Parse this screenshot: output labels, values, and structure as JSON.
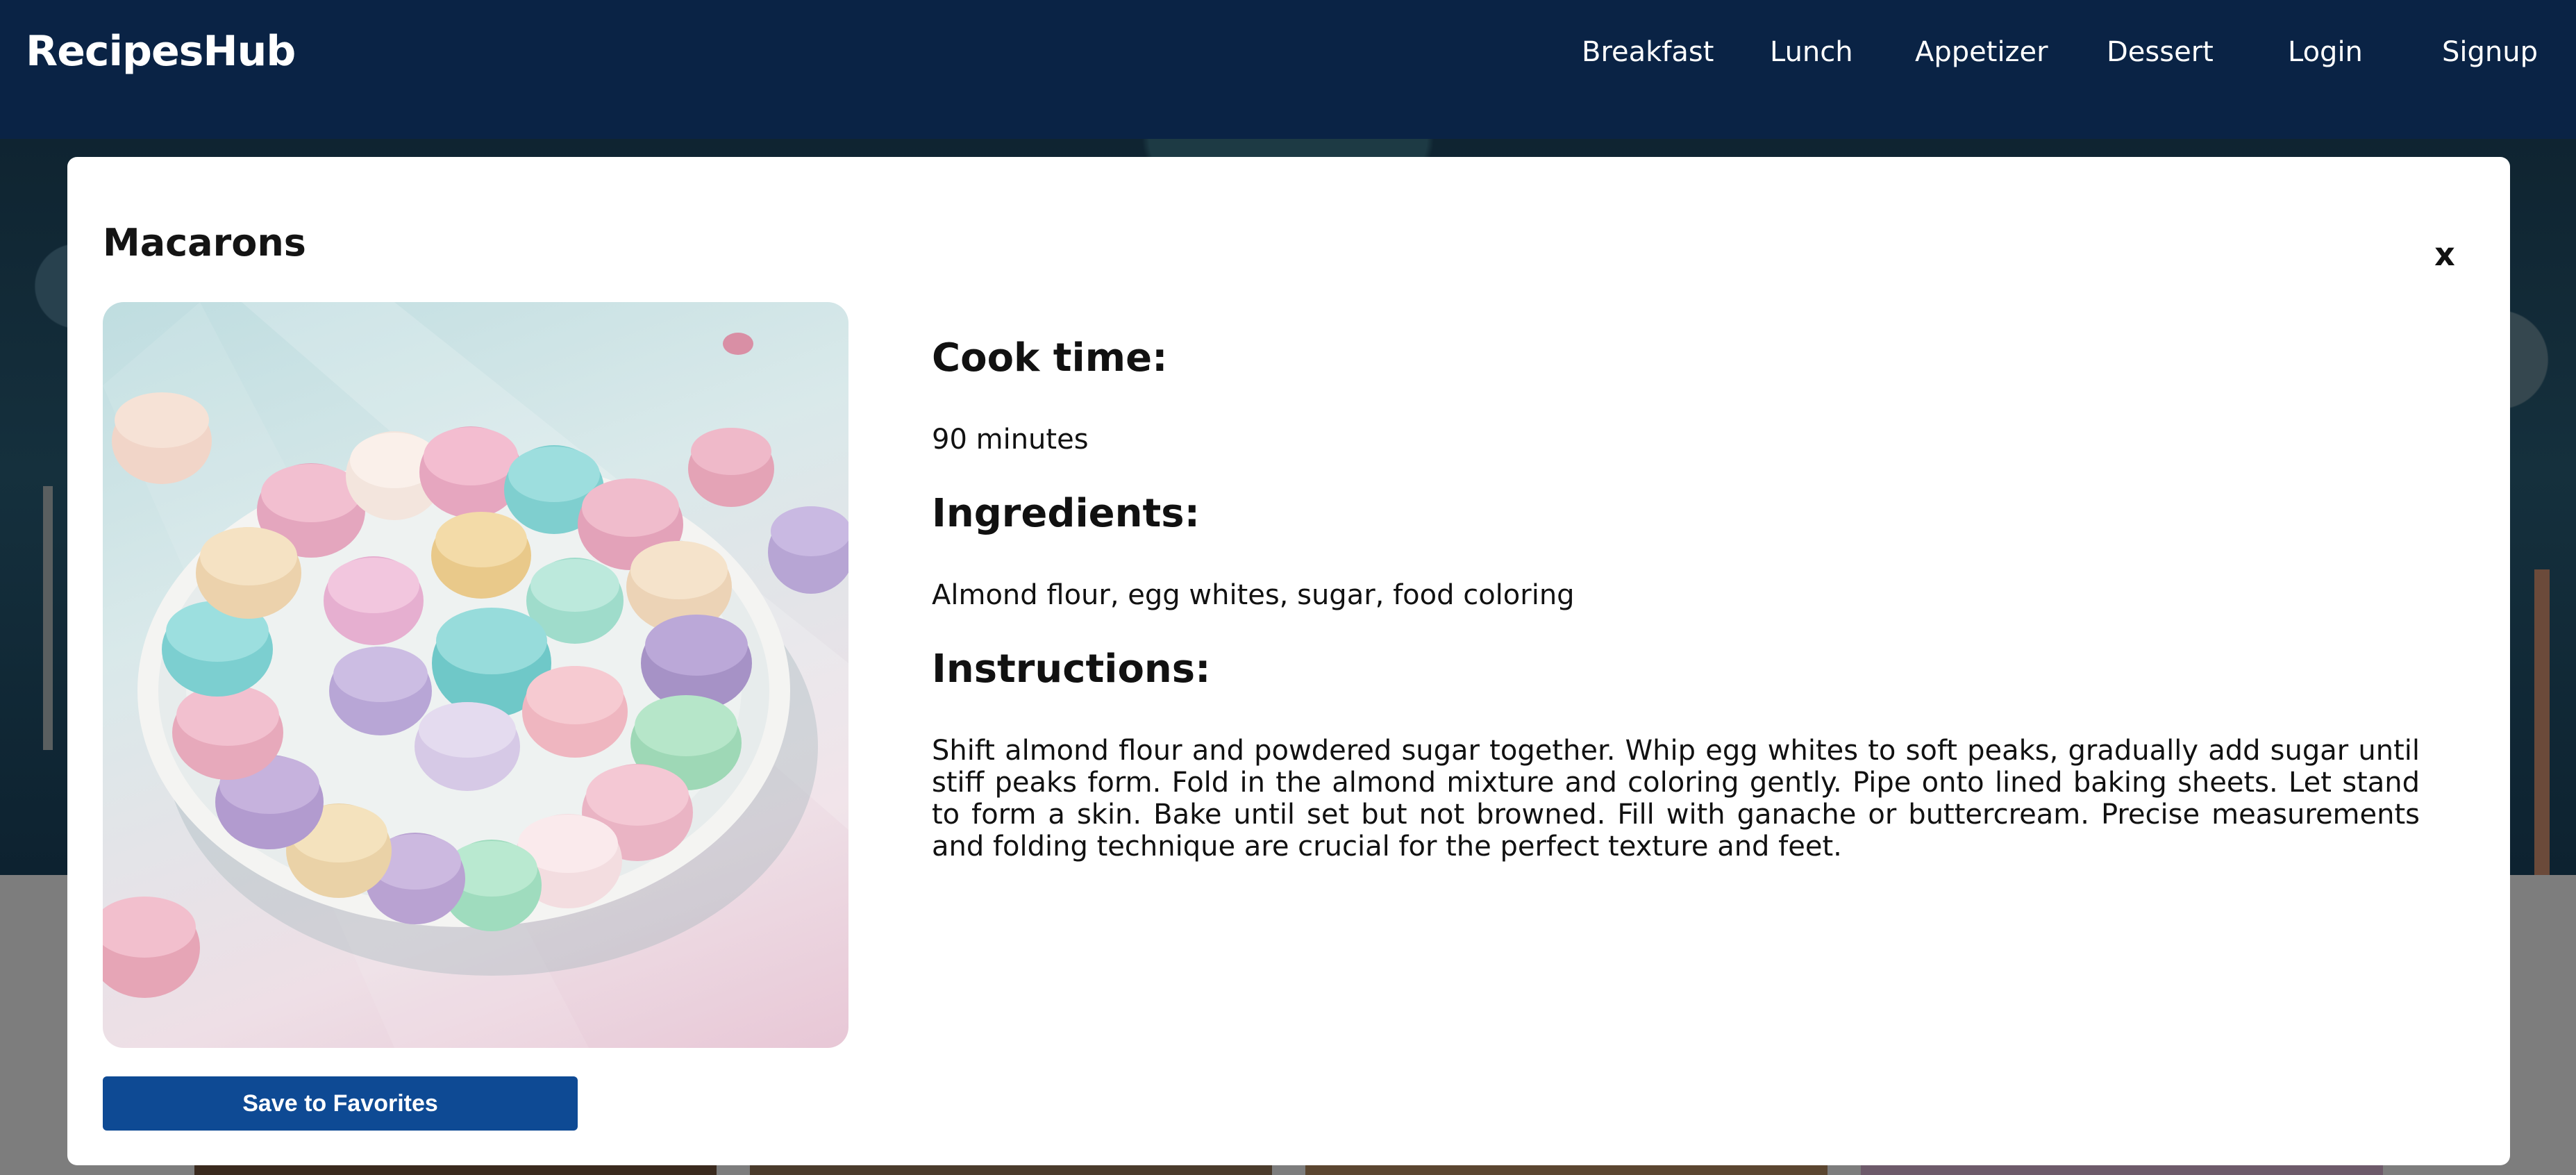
{
  "navbar": {
    "brand": "RecipesHub",
    "links": [
      "Breakfast",
      "Lunch",
      "Appetizer",
      "Dessert"
    ],
    "login_label": "Login",
    "signup_label": "Signup"
  },
  "modal": {
    "title": "Macarons",
    "close_label": "x",
    "image_alt": "Plate of pastel macarons",
    "cook_time_heading": "Cook time:",
    "cook_time": "90 minutes",
    "ingredients_heading": "Ingredients:",
    "ingredients": "Almond flour, egg whites, sugar, food coloring",
    "instructions_heading": "Instructions:",
    "instructions": "Shift almond flour and powdered sugar together. Whip egg whites to soft peaks, gradually add sugar until stiff peaks form. Fold in the almond mixture and coloring gently. Pipe onto lined baking sheets. Let stand to form a skin. Bake until set but not browned. Fill with ganache or buttercream. Precise measurements and folding technique are crucial for the perfect texture and feet.",
    "save_label": "Save to Favorites"
  },
  "colors": {
    "navbar_bg": "#0a2345",
    "button_bg": "#0e4a94",
    "overlay": "#7d7d7d"
  }
}
